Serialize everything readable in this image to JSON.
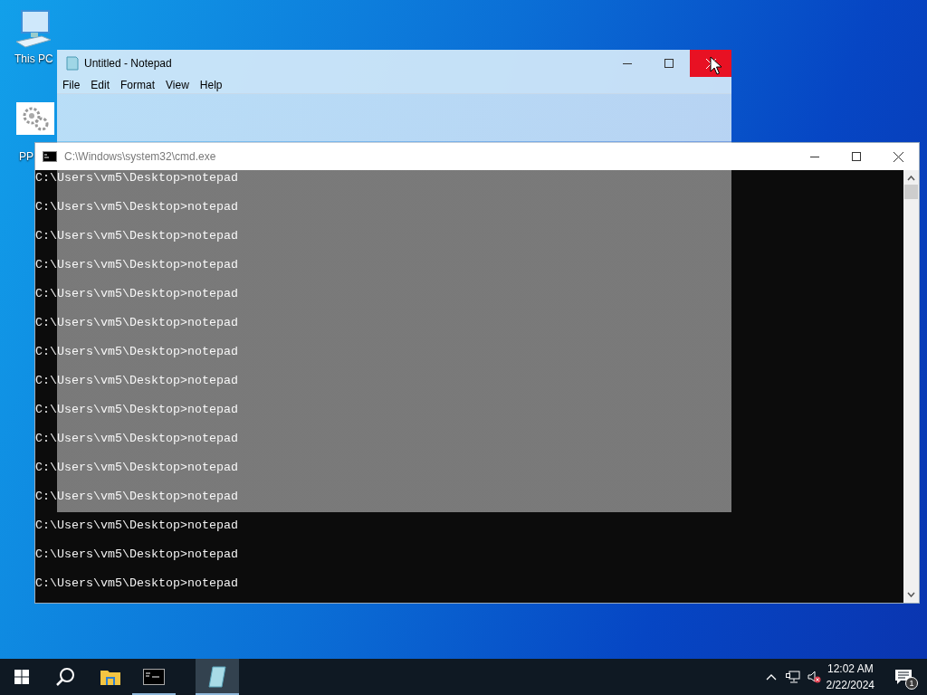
{
  "desktop_icons": [
    {
      "label": "This PC",
      "kind": "computer"
    },
    {
      "label": "PP",
      "kind": "settings"
    }
  ],
  "cmd_window": {
    "title": "C:\\Windows\\system32\\cmd.exe",
    "lines": [
      "C:\\Users\\vm5\\Desktop>notepad",
      "C:\\Users\\vm5\\Desktop>notepad",
      "C:\\Users\\vm5\\Desktop>notepad",
      "C:\\Users\\vm5\\Desktop>notepad",
      "C:\\Users\\vm5\\Desktop>notepad",
      "C:\\Users\\vm5\\Desktop>notepad",
      "C:\\Users\\vm5\\Desktop>notepad",
      "C:\\Users\\vm5\\Desktop>notepad",
      "C:\\Users\\vm5\\Desktop>notepad",
      "C:\\Users\\vm5\\Desktop>notepad",
      "C:\\Users\\vm5\\Desktop>notepad",
      "C:\\Users\\vm5\\Desktop>notepad",
      "C:\\Users\\vm5\\Desktop>notepad",
      "C:\\Users\\vm5\\Desktop>notepad",
      "C:\\Users\\vm5\\Desktop>notepad"
    ]
  },
  "notepad_window": {
    "title": "Untitled - Notepad",
    "close_hovered": true,
    "menu": [
      "File",
      "Edit",
      "Format",
      "View",
      "Help"
    ]
  },
  "taskbar": {
    "apps": [
      {
        "kind": "explorer",
        "running": false,
        "selected": false
      },
      {
        "kind": "cmd",
        "running": true,
        "selected": false
      },
      {
        "kind": "notepad",
        "running": true,
        "selected": true
      }
    ],
    "time": "12:02 AM",
    "date": "2/22/2024",
    "notifications": "1"
  }
}
